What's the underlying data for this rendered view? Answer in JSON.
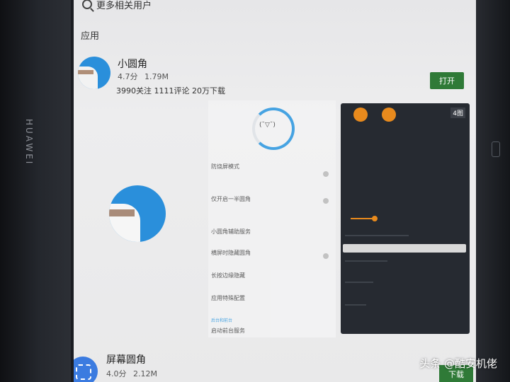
{
  "device": {
    "brand": "HUAWEI"
  },
  "search": {
    "label": "更多相关用户"
  },
  "section": {
    "title": "应用"
  },
  "app1": {
    "name": "小圆角",
    "rating": "4.7分",
    "size": "1.79M",
    "stats": "3990关注  1111评论  20万下载",
    "open_label": "打开"
  },
  "app2": {
    "name": "屏幕圆角",
    "rating": "4.0分",
    "size": "2.12M",
    "button_label": "下载"
  },
  "screenshot_left": {
    "face": "(˘▽˘)",
    "items": [
      {
        "title": "防烧屏模式"
      },
      {
        "title": "仅开启一半圆角"
      },
      {
        "title": "小圆角辅助服务"
      },
      {
        "title": "横屏时隐藏圆角"
      },
      {
        "title": "长按边缘隐藏"
      },
      {
        "title": "应用特殊配置"
      },
      {
        "title": "启动前台服务"
      }
    ],
    "link": "后台和前台"
  },
  "screenshot_right": {
    "corner_label": "4图"
  },
  "watermark": "头条 @酷安机佬",
  "colors": {
    "accent": "#2a97e0",
    "button_green": "#2f7a37",
    "orange": "#e88a1d"
  }
}
